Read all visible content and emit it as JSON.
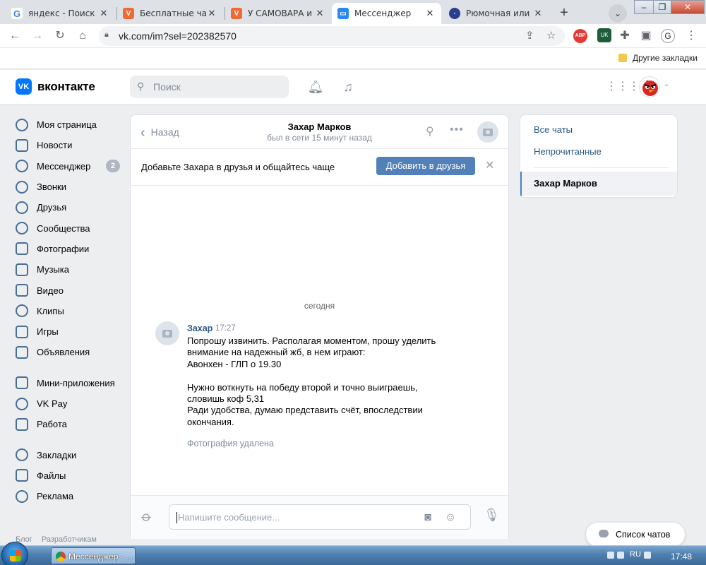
{
  "browser": {
    "tabs": [
      {
        "title": "яндекс - Поиск в",
        "icon": "google-g-icon",
        "active": false
      },
      {
        "title": "Бесплатные чатЫ",
        "icon": "vchat-icon",
        "active": false
      },
      {
        "title": "У САМОВАРА и к",
        "icon": "vchat-icon",
        "active": false
      },
      {
        "title": "Мессенджер",
        "icon": "vk-messenger-icon",
        "active": true
      },
      {
        "title": "Рюмочная или И",
        "icon": "site-icon",
        "active": false
      }
    ],
    "url": "vk.com/im?sel=202382570",
    "bookmarks_folder": "Другие закладки",
    "profile_initial": "G"
  },
  "vk_header": {
    "logo_text": "вконтакте",
    "logo_mark": "VK",
    "search_placeholder": "Поиск"
  },
  "sidebar": {
    "items": [
      {
        "label": "Моя страница",
        "icon": "user-icon"
      },
      {
        "label": "Новости",
        "icon": "news-icon"
      },
      {
        "label": "Мессенджер",
        "icon": "message-icon",
        "badge": "2"
      },
      {
        "label": "Звонки",
        "icon": "phone-icon"
      },
      {
        "label": "Друзья",
        "icon": "friends-icon"
      },
      {
        "label": "Сообщества",
        "icon": "communities-icon"
      },
      {
        "label": "Фотографии",
        "icon": "photo-icon"
      },
      {
        "label": "Музыка",
        "icon": "music-icon"
      },
      {
        "label": "Видео",
        "icon": "video-icon"
      },
      {
        "label": "Клипы",
        "icon": "clips-icon"
      },
      {
        "label": "Игры",
        "icon": "games-icon"
      },
      {
        "label": "Объявления",
        "icon": "classifieds-icon"
      },
      {
        "label": "Мини-приложения",
        "icon": "mini-apps-icon"
      },
      {
        "label": "VK Pay",
        "icon": "vkpay-icon"
      },
      {
        "label": "Работа",
        "icon": "work-icon"
      },
      {
        "label": "Закладки",
        "icon": "bookmark-icon"
      },
      {
        "label": "Файлы",
        "icon": "files-icon"
      },
      {
        "label": "Реклама",
        "icon": "ads-icon"
      }
    ],
    "footer": [
      "Блог",
      "Разработчикам"
    ]
  },
  "chat": {
    "back_label": "Назад",
    "peer_name": "Захар Марков",
    "peer_status": "был в сети 15 минут назад",
    "friend_prompt": "Добавьте Захара в друзья и общайтесь чаще",
    "add_friend_label": "Добавить в друзья",
    "date_separator": "сегодня",
    "message": {
      "author": "Захар",
      "time": "17:27",
      "text": "Попрошу извинить. Располагая моментом, прошу уделить внимание на надежный жб, в нем играют:\nАвонхен - ГЛП о 19.30\n\nНужно воткнуть на победу второй и точно выиграешь, словишь коф 5,31\nРади удобства, думаю представить счёт, впоследствии окончания.",
      "deleted_note": "Фотография удалена"
    },
    "composer_placeholder": "Напишите сообщение..."
  },
  "right_panel": {
    "all_chats": "Все чаты",
    "unread": "Непрочитанные",
    "active_chat": "Захар Марков"
  },
  "chat_list_button": "Список чатов",
  "taskbar": {
    "item": "Мессенджер - ...",
    "lang": "RU",
    "clock": "17:48"
  },
  "colors": {
    "vk_blue": "#0077ff",
    "link": "#2a5885",
    "button": "#5181b8",
    "background": "#edeef0"
  }
}
